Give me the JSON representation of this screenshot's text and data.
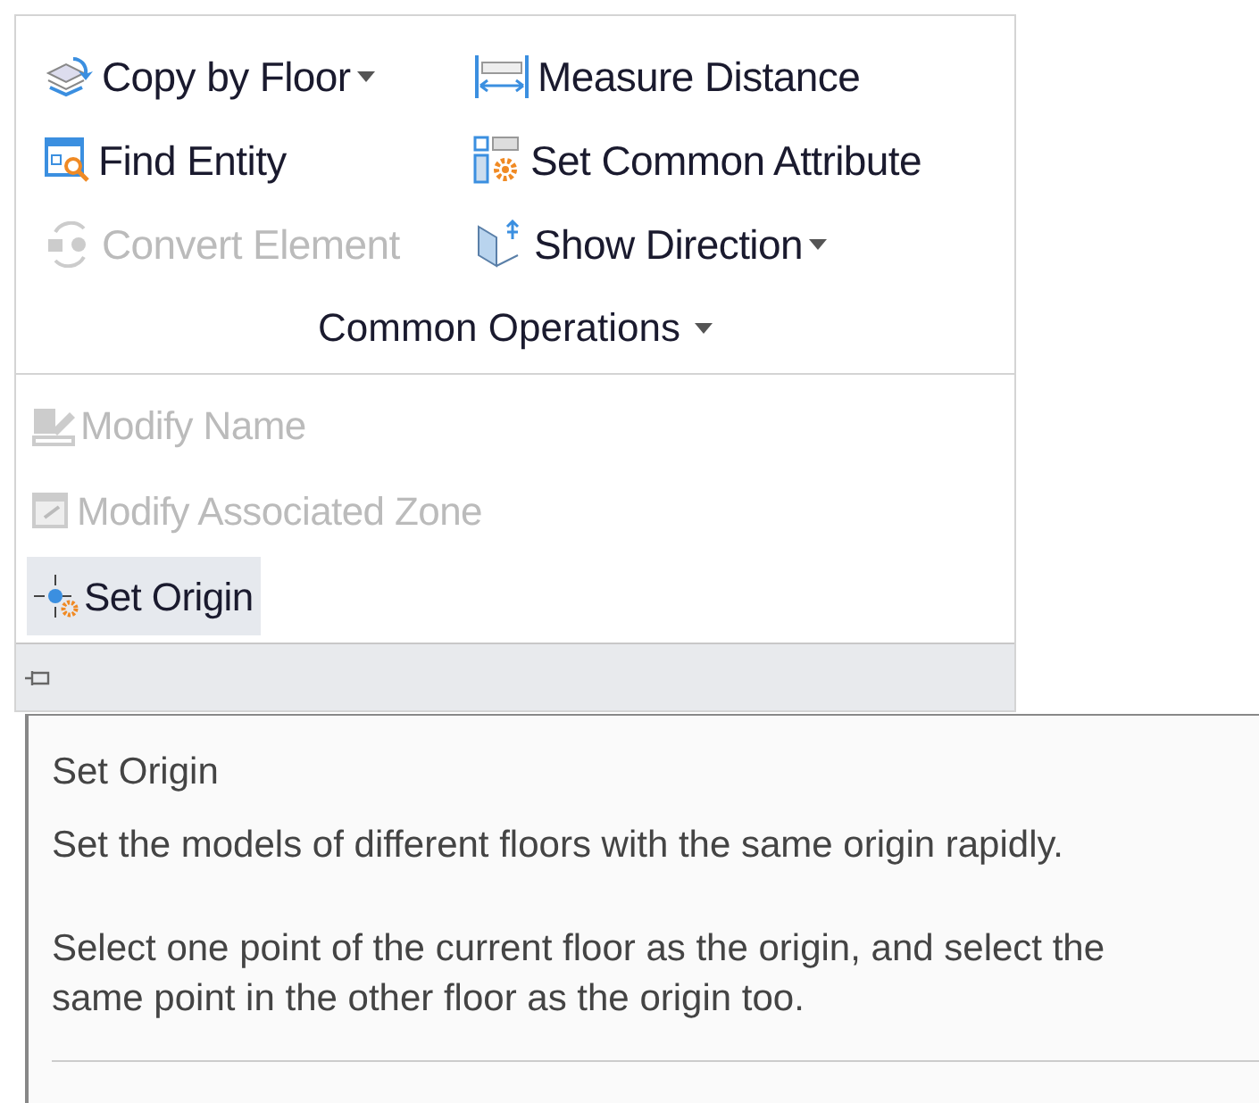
{
  "ribbon": {
    "tools": [
      {
        "label": "Copy by Floor",
        "disabled": false,
        "dropdown": true
      },
      {
        "label": "Measure Distance",
        "disabled": false,
        "dropdown": false
      },
      {
        "label": "Find Entity",
        "disabled": false,
        "dropdown": false
      },
      {
        "label": "Set Common Attribute",
        "disabled": false,
        "dropdown": false
      },
      {
        "label": "Convert Element",
        "disabled": true,
        "dropdown": false
      },
      {
        "label": "Show Direction",
        "disabled": false,
        "dropdown": true
      }
    ],
    "group_label": "Common Operations",
    "group_dropdown": true
  },
  "menu": {
    "items": [
      {
        "label": "Modify Name",
        "disabled": true,
        "selected": false
      },
      {
        "label": "Modify Associated Zone",
        "disabled": true,
        "selected": false
      },
      {
        "label": "Set Origin",
        "disabled": false,
        "selected": true
      }
    ]
  },
  "tooltip": {
    "title": "Set Origin",
    "paragraphs": [
      "Set the models of different floors with the same origin rapidly.",
      "Select one point of the current floor as the origin, and select the same point in the other floor as the origin too."
    ]
  }
}
